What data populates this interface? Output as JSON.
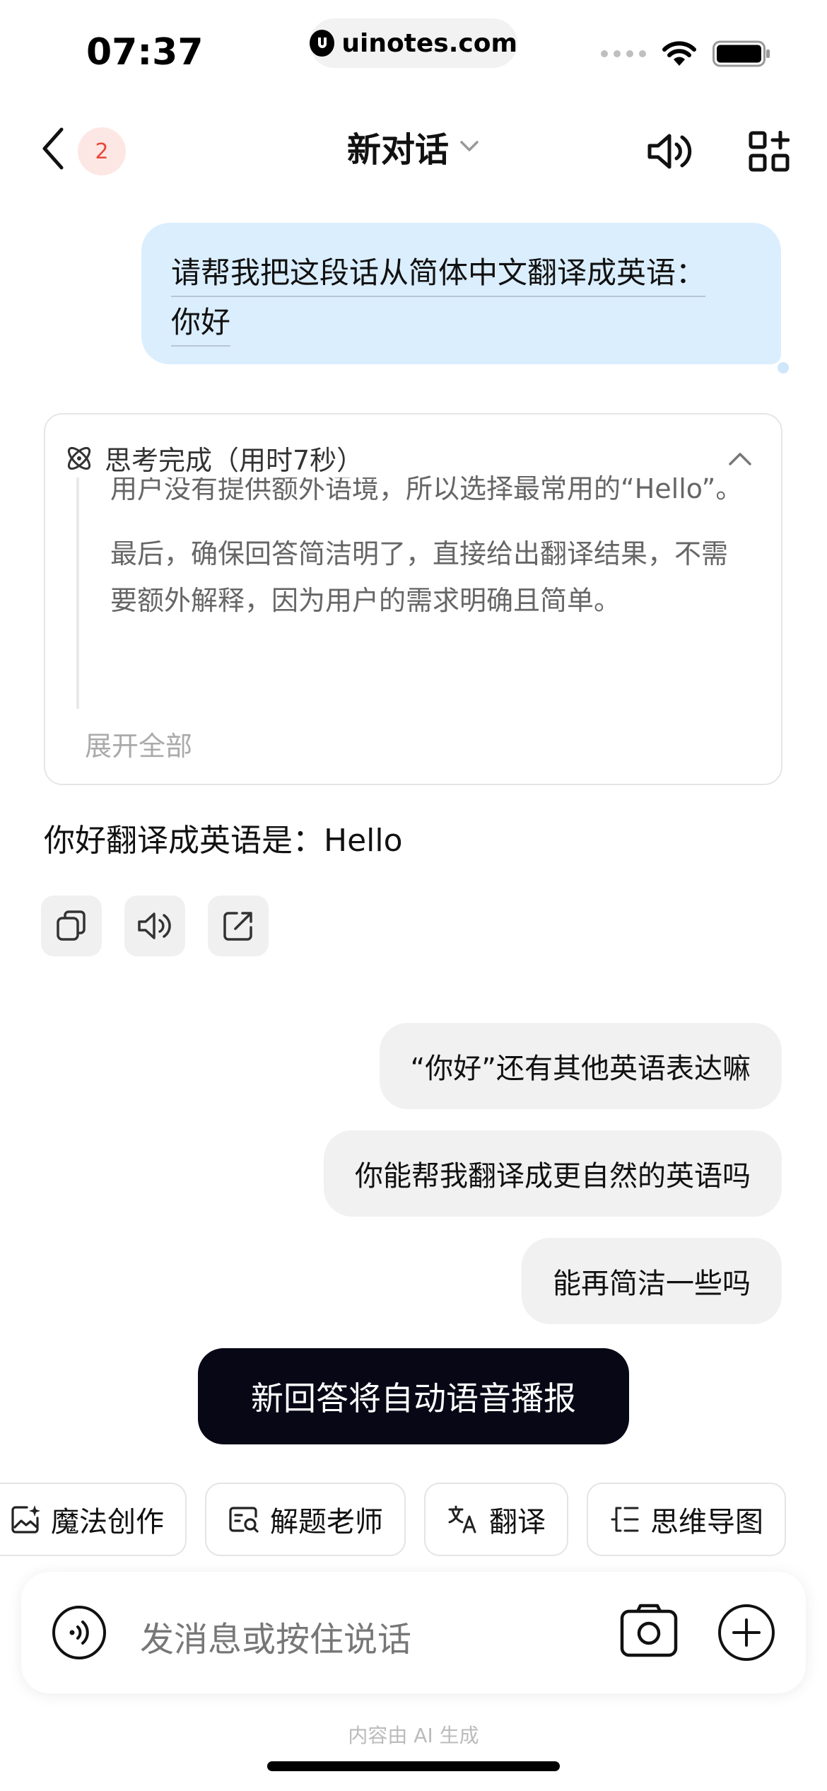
{
  "status_bar": {
    "time": "07:37",
    "url": "uinotes.com"
  },
  "header": {
    "unread_count": "2",
    "title": "新对话"
  },
  "user_message": {
    "line1": "请帮我把这段话从简体中文翻译成英语：",
    "line2": "你好"
  },
  "thinking": {
    "status": "思考完成（用时7秒）",
    "para_cut": "用户没有提供额外语境，所以选择最常用的“Hello”。",
    "para_final": "最后，确保回答简洁明了，直接给出翻译结果，不需要额外解释，因为用户的需求明确且简单。",
    "expand_label": "展开全部"
  },
  "answer": "你好翻译成英语是：Hello",
  "suggestions": [
    "“你好”还有其他英语表达嘛",
    "你能帮我翻译成更自然的英语吗",
    "能再简洁一些吗"
  ],
  "toast": "新回答将自动语音播报",
  "quick_actions": [
    "魔法创作",
    "解题老师",
    "翻译",
    "思维导图"
  ],
  "input": {
    "placeholder": "发消息或按住说话"
  },
  "footer": {
    "ai_note": "内容由 AI 生成"
  }
}
